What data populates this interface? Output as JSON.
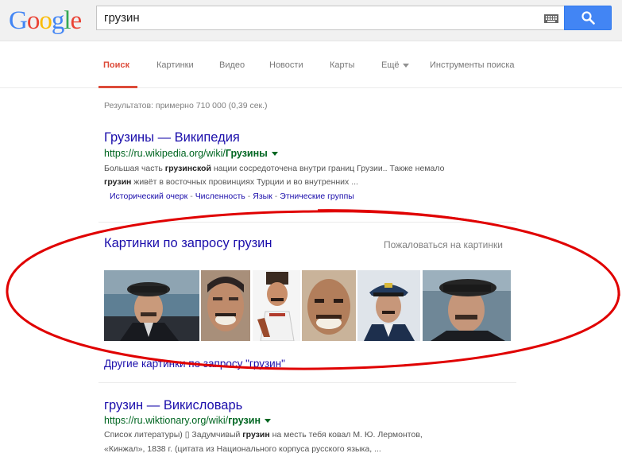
{
  "header": {
    "logo_letters": [
      {
        "ch": "G",
        "color": "#4285f4"
      },
      {
        "ch": "o",
        "color": "#ea4335"
      },
      {
        "ch": "o",
        "color": "#fbbc05"
      },
      {
        "ch": "g",
        "color": "#4285f4"
      },
      {
        "ch": "l",
        "color": "#34a853"
      },
      {
        "ch": "e",
        "color": "#ea4335"
      }
    ],
    "search_value": "грузин",
    "keyboard_icon": "keyboard-icon",
    "search_icon": "search-icon"
  },
  "nav": {
    "items": [
      "Поиск",
      "Картинки",
      "Видео",
      "Новости",
      "Карты",
      "Ещё",
      "Инструменты поиска"
    ],
    "active": "Поиск"
  },
  "stats": "Результатов: примерно 710 000 (0,39 сек.)",
  "result1": {
    "title": "Грузины — Википедия",
    "url_prefix": "https://ru.wikipedia.org/wiki/",
    "url_bold": "Грузины",
    "snippet_line1": [
      {
        "t": "Большая часть ",
        "b": false
      },
      {
        "t": "грузинской",
        "b": true
      },
      {
        "t": " нации сосредоточена внутри границ Грузии.. Также немало",
        "b": false
      }
    ],
    "snippet_line2": [
      {
        "t": "грузин",
        "b": true
      },
      {
        "t": " живёт в восточных провинциях Турции и во внутренних ...",
        "b": false
      }
    ],
    "sitelinks": [
      "Исторический очерк",
      "Численность",
      "Язык",
      "Этнические группы"
    ],
    "sitelink_sep": "-"
  },
  "images": {
    "heading": "Картинки по запросу грузин",
    "report": "Пожаловаться на картинки",
    "more": "Другие картинки по запросу \"грузин\""
  },
  "result2": {
    "title": "грузин — Викисловарь",
    "url_prefix": "https://ru.wiktionary.org/wiki/",
    "url_bold": "грузин",
    "snippet_line1": [
      {
        "t": "Список литературы) ",
        "b": false
      },
      {
        "t": "▯",
        "b": false
      },
      {
        "t": " Задумчивый ",
        "b": false
      },
      {
        "t": "грузин",
        "b": true
      },
      {
        "t": " на месть тебя ковал М. Ю. Лермонтов,",
        "b": false
      }
    ],
    "snippet_line2": [
      {
        "t": "«Кинжал», 1838 г. (цитата из Национального корпуса русского языка, ...",
        "b": false
      }
    ]
  },
  "colors": {
    "link": "#1a0dab",
    "url": "#006621",
    "active_tab": "#dd4b39",
    "annotation_oval": "#e00000"
  }
}
